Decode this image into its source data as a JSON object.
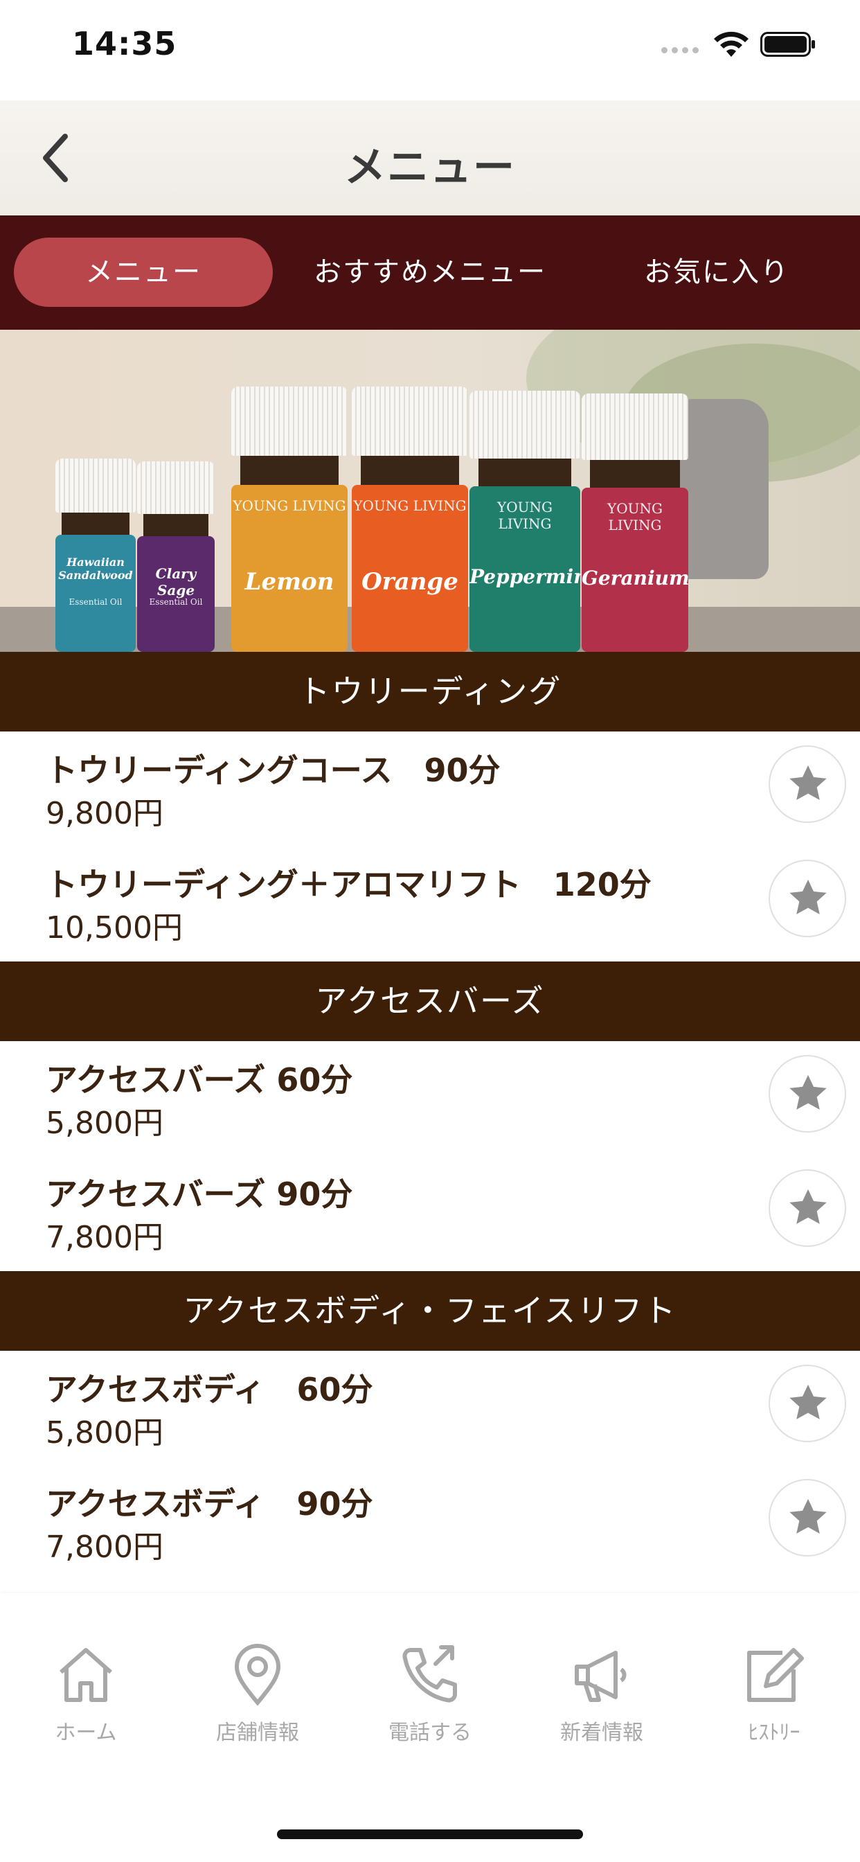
{
  "status_bar": {
    "time": "14:35"
  },
  "header": {
    "title": "メニュー"
  },
  "tabs": [
    {
      "label": "メニュー",
      "active": true
    },
    {
      "label": "おすすめメニュー",
      "active": false
    },
    {
      "label": "お気に入り",
      "active": false
    }
  ],
  "hero": {
    "bottles": [
      {
        "label": "Hawaiian Sandalwood",
        "brand": "Essential Oil",
        "color": "#2f8aa0"
      },
      {
        "label": "Clary Sage",
        "brand": "Essential Oil",
        "color": "#5a2a6b"
      },
      {
        "label": "Lemon",
        "brand": "YOUNG LIVING",
        "color": "#e39a2f"
      },
      {
        "label": "Orange",
        "brand": "YOUNG LIVING",
        "color": "#e85d22"
      },
      {
        "label": "Peppermint",
        "brand": "YOUNG LIVING",
        "color": "#1f7f6b"
      },
      {
        "label": "Geranium",
        "brand": "YOUNG LIVING",
        "color": "#b2304a"
      }
    ]
  },
  "sections": [
    {
      "title": "トウリーディング",
      "items": [
        {
          "name": "トウリーディングコース　90分",
          "price": "9,800円"
        },
        {
          "name": "トウリーディング＋アロマリフト　120分",
          "price": "10,500円"
        }
      ]
    },
    {
      "title": "アクセスバーズ",
      "items": [
        {
          "name": "アクセスバーズ 60分",
          "price": "5,800円"
        },
        {
          "name": "アクセスバーズ 90分",
          "price": "7,800円"
        }
      ]
    },
    {
      "title": "アクセスボディ・フェイスリフト",
      "items": [
        {
          "name": "アクセスボディ　60分",
          "price": "5,800円"
        },
        {
          "name": "アクセスボディ　90分",
          "price": "7,800円"
        }
      ]
    }
  ],
  "bottom_nav": [
    {
      "label": "ホーム",
      "icon": "home-icon"
    },
    {
      "label": "店舗情報",
      "icon": "location-pin-icon"
    },
    {
      "label": "電話する",
      "icon": "phone-icon"
    },
    {
      "label": "新着情報",
      "icon": "megaphone-icon"
    },
    {
      "label": "ﾋｽﾄﾘｰ",
      "icon": "edit-icon"
    }
  ],
  "colors": {
    "tab_bar": "#4a0f10",
    "tab_active": "#b9464a",
    "section_header": "#3d1e06",
    "text": "#3b2312",
    "star": "#8e8e8e",
    "nav_inactive": "#a8a8a8"
  }
}
